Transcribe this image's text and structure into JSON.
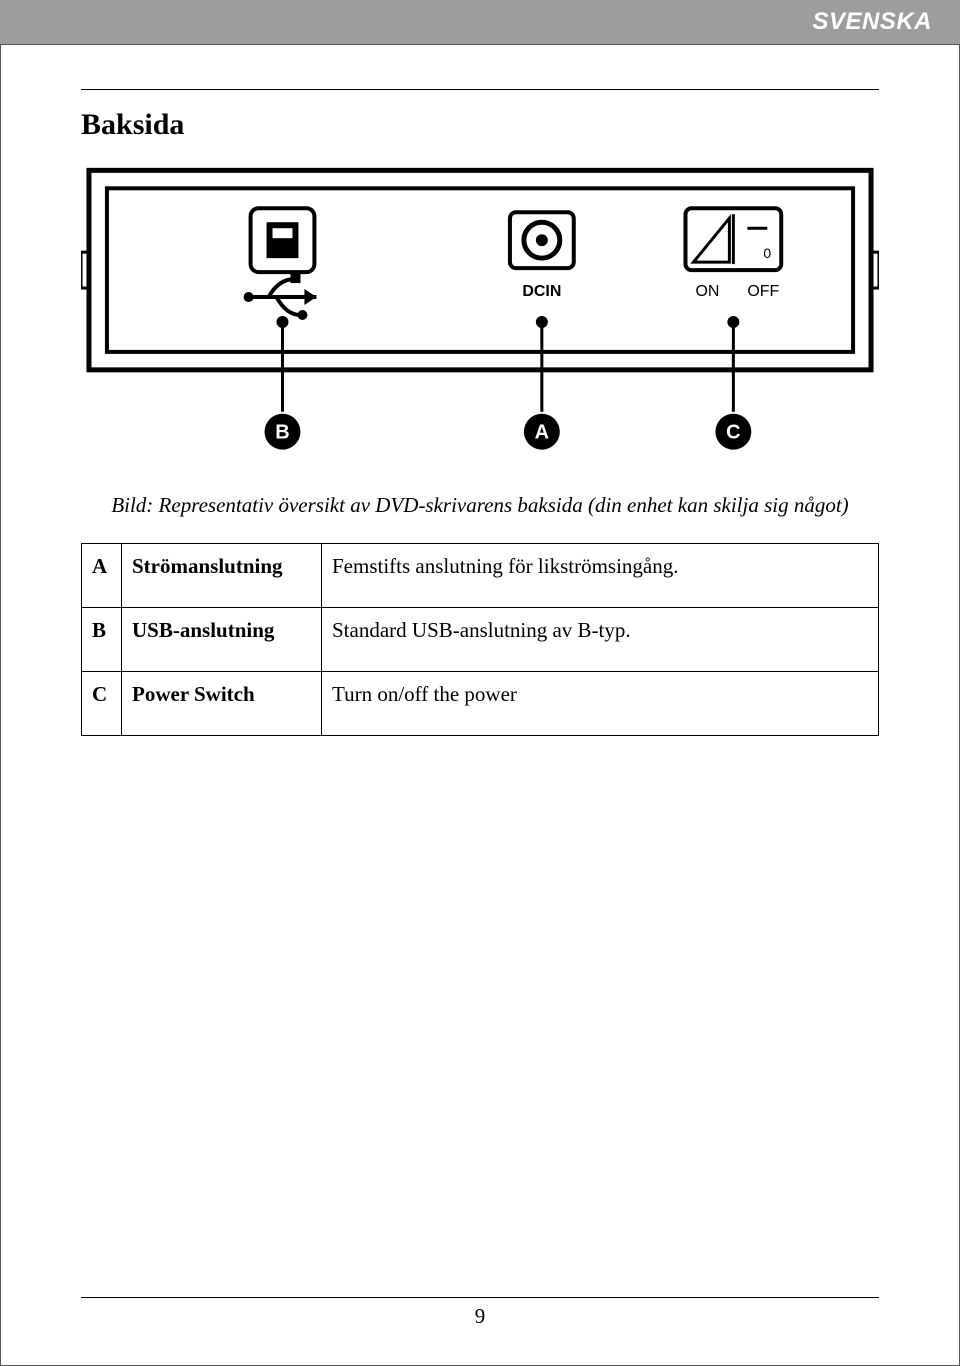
{
  "header": {
    "language": "SVENSKA"
  },
  "section": {
    "title": "Baksida"
  },
  "diagram": {
    "dcin_label": "DCIN",
    "on_label": "ON",
    "off_label": "OFF",
    "callouts": {
      "b": "B",
      "a": "A",
      "c": "C"
    }
  },
  "caption": "Bild: Representativ översikt av DVD-skrivarens baksida (din enhet kan skilja sig något)",
  "table": {
    "rows": [
      {
        "id": "A",
        "name": "Strömanslutning",
        "desc": "Femstifts anslutning för likströmsingång."
      },
      {
        "id": "B",
        "name": "USB-anslutning",
        "desc": "Standard USB-anslutning av B-typ."
      },
      {
        "id": "C",
        "name": "Power Switch",
        "desc": "Turn on/off  the power"
      }
    ]
  },
  "footer": {
    "page": "9"
  }
}
